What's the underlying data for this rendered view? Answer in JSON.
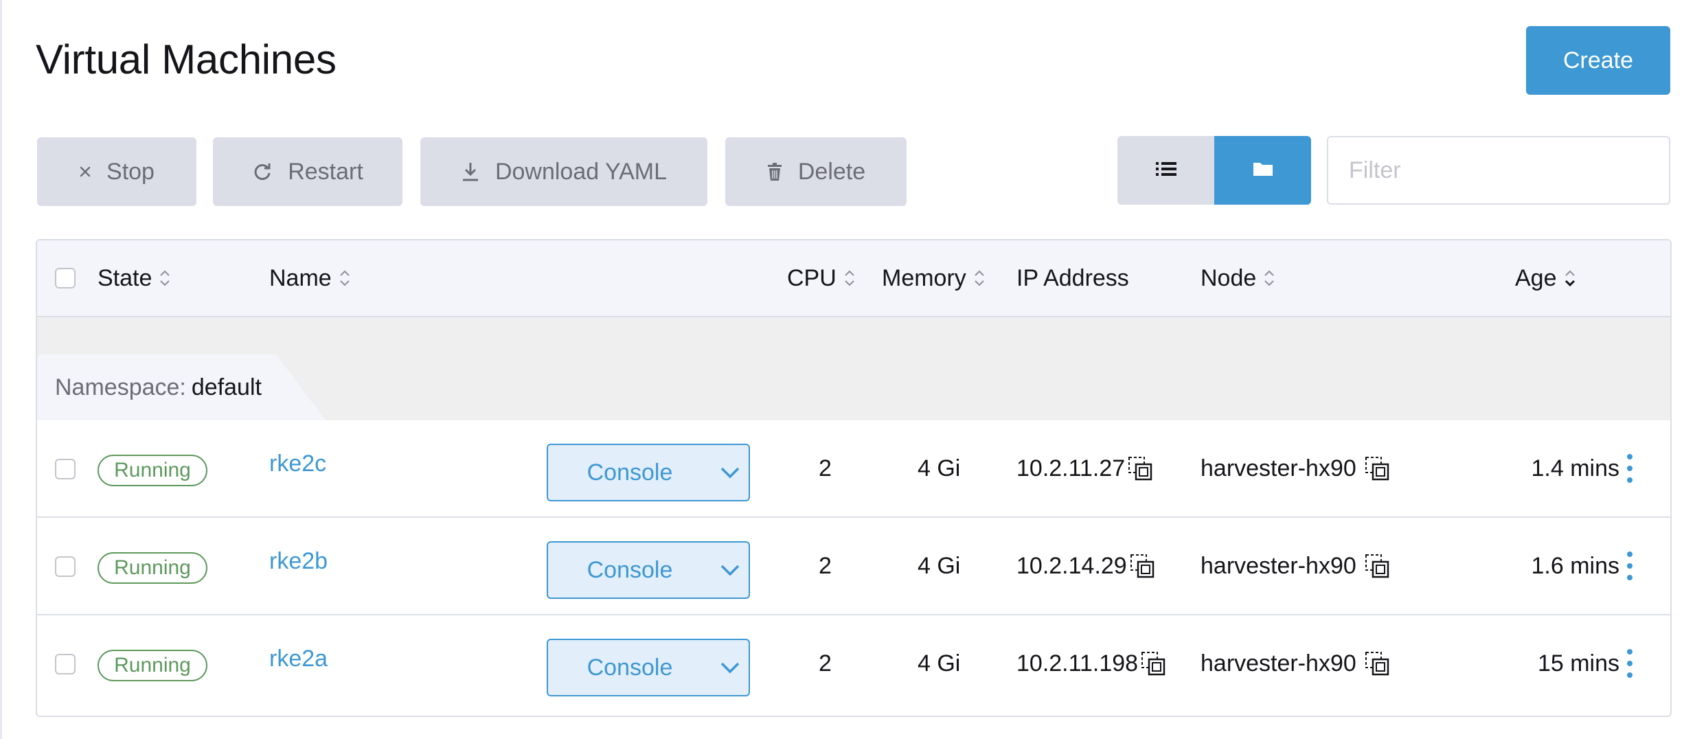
{
  "page": {
    "title": "Virtual Machines"
  },
  "actions": {
    "create_label": "Create"
  },
  "bulk_actions": [
    {
      "label": "Stop",
      "icon": "close-icon"
    },
    {
      "label": "Restart",
      "icon": "refresh-icon"
    },
    {
      "label": "Download YAML",
      "icon": "download-icon"
    },
    {
      "label": "Delete",
      "icon": "trash-icon"
    }
  ],
  "view_toggle": {
    "options": [
      "list-view-icon",
      "folder-view-icon"
    ],
    "selected": "folder-view-icon"
  },
  "filter": {
    "placeholder": "Filter",
    "value": ""
  },
  "table": {
    "columns": {
      "state": "State",
      "name": "Name",
      "cpu": "CPU",
      "memory": "Memory",
      "ip": "IP Address",
      "node": "Node",
      "age": "Age"
    },
    "group": {
      "label": "Namespace:",
      "value": "default"
    },
    "rows": [
      {
        "state": "Running",
        "name": "rke2c",
        "console": "Console",
        "cpu": "2",
        "memory": "4 Gi",
        "ip": "10.2.11.27",
        "node": "harvester-hx90",
        "age": "1.4 mins"
      },
      {
        "state": "Running",
        "name": "rke2b",
        "console": "Console",
        "cpu": "2",
        "memory": "4 Gi",
        "ip": "10.2.14.29",
        "node": "harvester-hx90",
        "age": "1.6 mins"
      },
      {
        "state": "Running",
        "name": "rke2a",
        "console": "Console",
        "cpu": "2",
        "memory": "4 Gi",
        "ip": "10.2.11.198",
        "node": "harvester-hx90",
        "age": "15 mins"
      }
    ]
  },
  "colors": {
    "accent": "#3d98d3",
    "running": "#5d995d",
    "muted_button": "#dcdee7"
  }
}
